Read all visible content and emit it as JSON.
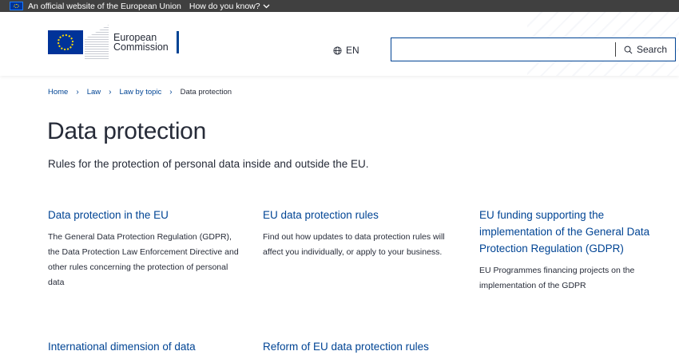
{
  "eu_bar": {
    "text": "An official website of the European Union",
    "how": "How do you know?"
  },
  "header": {
    "logo_line1": "European",
    "logo_line2": "Commission",
    "language": "EN",
    "search": {
      "value": "",
      "placeholder": "",
      "button": "Search"
    }
  },
  "breadcrumb": [
    "Home",
    "Law",
    "Law by topic",
    "Data protection"
  ],
  "page": {
    "title": "Data protection",
    "lead": "Rules for the protection of personal data inside and outside the EU."
  },
  "cards": [
    {
      "title": "Data protection in the EU",
      "desc": "The General Data Protection Regulation (GDPR), the Data Protection Law Enforcement Directive and other rules concerning the protection of personal data"
    },
    {
      "title": "EU data protection rules",
      "desc": "Find out how updates to data protection rules will affect you individually, or apply to your business."
    },
    {
      "title": "EU funding supporting the implementation of the General Data Protection Regulation (GDPR)",
      "desc": "EU Programmes financing projects on the implementation of the GDPR"
    },
    {
      "title": "International dimension of data",
      "desc": ""
    },
    {
      "title": "Reform of EU data protection rules",
      "desc": ""
    }
  ],
  "colors": {
    "link": "#004494",
    "eu_bar": "#404040",
    "text": "#262b38"
  }
}
